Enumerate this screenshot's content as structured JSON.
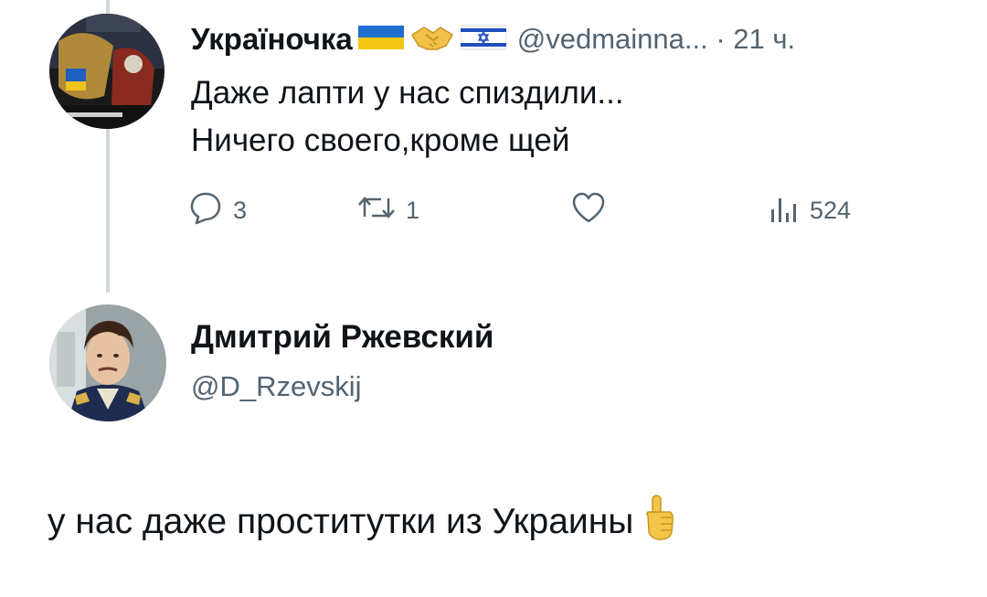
{
  "parent_tweet": {
    "display_name": "Украïночка",
    "emojis": [
      "ukraine-flag-icon",
      "handshake-icon",
      "israel-flag-icon"
    ],
    "handle_time": "@vedmainna... · 21 ч.",
    "text_lines": [
      "Даже лапти у нас спиздили...",
      "Ничего своего,кроме щей"
    ],
    "actions": {
      "replies": "3",
      "retweets": "1",
      "views": "524"
    }
  },
  "reply_tweet": {
    "display_name": "Дмитрий Ржевский",
    "handle": "@D_Rzevskij",
    "text": "у нас даже проститутки из Украины",
    "emoji": "index-pointing-up-icon"
  },
  "colors": {
    "text": "#0f1419",
    "secondary": "#536471",
    "thread_line": "#cfd9de"
  }
}
